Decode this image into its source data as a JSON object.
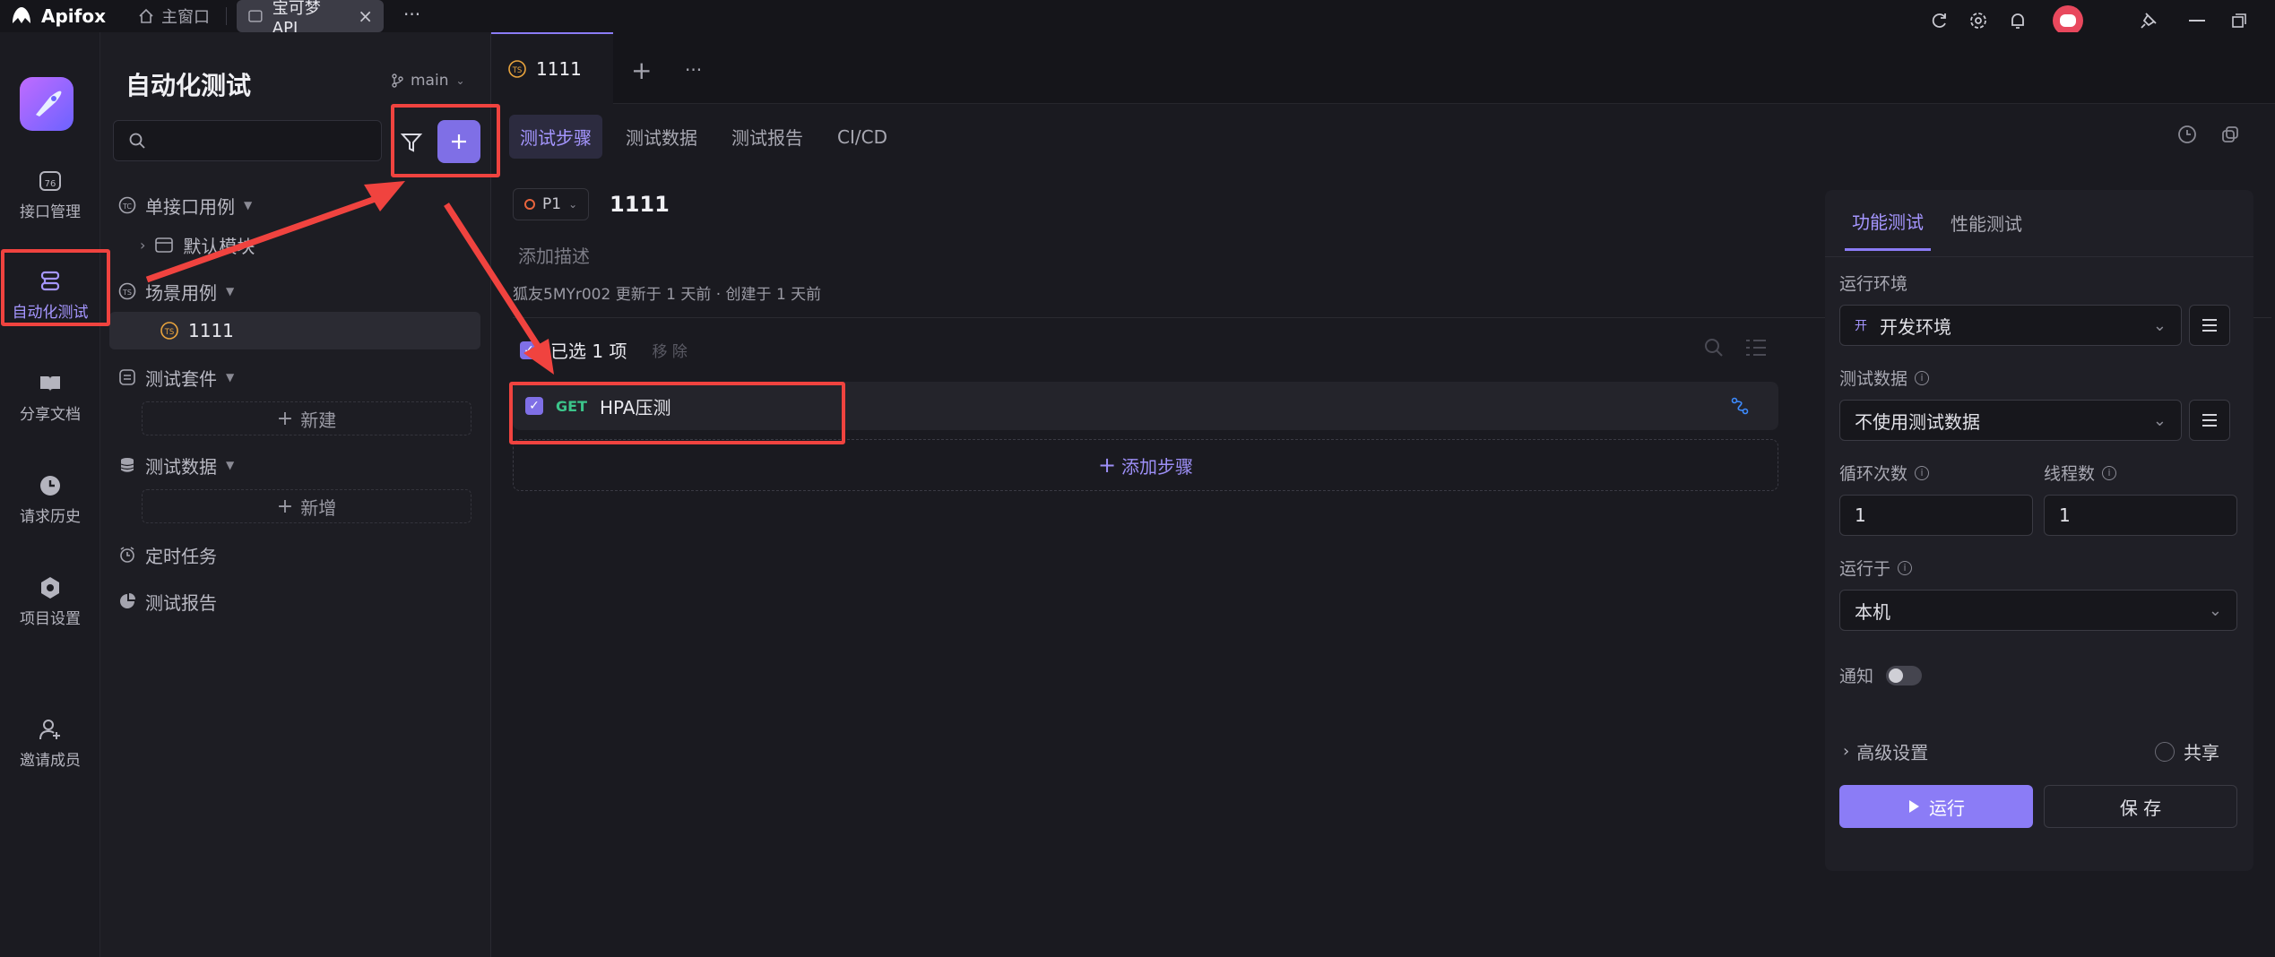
{
  "app": {
    "name": "Apifox"
  },
  "titlebar": {
    "tabs": [
      {
        "label": "主窗口",
        "icon": "home-icon"
      },
      {
        "label": "宝可梦API",
        "icon": "project-icon"
      }
    ],
    "more": "···"
  },
  "rail": {
    "items": [
      {
        "label": "接口管理",
        "icon": "api-icon"
      },
      {
        "label": "自动化测试",
        "icon": "automation-icon",
        "active": true
      },
      {
        "label": "分享文档",
        "icon": "book-icon"
      },
      {
        "label": "请求历史",
        "icon": "clock-icon"
      },
      {
        "label": "项目设置",
        "icon": "settings-icon"
      },
      {
        "label": "邀请成员",
        "icon": "add-user-icon"
      }
    ]
  },
  "tree": {
    "title": "自动化测试",
    "branch": "main",
    "search_placeholder": "",
    "items": {
      "single": "单接口用例",
      "default_module": "默认模块",
      "scenario": "场景用例",
      "case_1111": "1111",
      "suite": "测试套件",
      "suite_new": "新建",
      "data": "测试数据",
      "data_new": "新增",
      "timer": "定时任务",
      "report": "测试报告"
    }
  },
  "editor_tabs": {
    "active": "1111",
    "badge": "TS",
    "add": "+",
    "more": "···"
  },
  "subtabs": [
    "测试步骤",
    "测试数据",
    "测试报告",
    "CI/CD"
  ],
  "case": {
    "priority": "P1",
    "name": "1111",
    "desc_placeholder": "添加描述",
    "meta": "狐友5MYr002 更新于 1 天前 · 创建于 1 天前",
    "selected": "已选 1 项",
    "remove": "移 除",
    "step": {
      "method": "GET",
      "name": "HPA压测"
    },
    "add_step": "添加步骤"
  },
  "right": {
    "tabs": [
      "功能测试",
      "性能测试"
    ],
    "env_label": "运行环境",
    "env_badge": "开",
    "env_value": "开发环境",
    "data_label": "测试数据",
    "data_value": "不使用测试数据",
    "loop_label": "循环次数",
    "loop_value": "1",
    "thread_label": "线程数",
    "thread_value": "1",
    "runon_label": "运行于",
    "runon_value": "本机",
    "notify_label": "通知",
    "notify_on": false,
    "advanced": "高级设置",
    "share": "共享",
    "run": "运行",
    "save": "保 存"
  },
  "colors": {
    "accent": "#8b7cf6",
    "annotation": "#f0433f",
    "get": "#3cc48a"
  }
}
